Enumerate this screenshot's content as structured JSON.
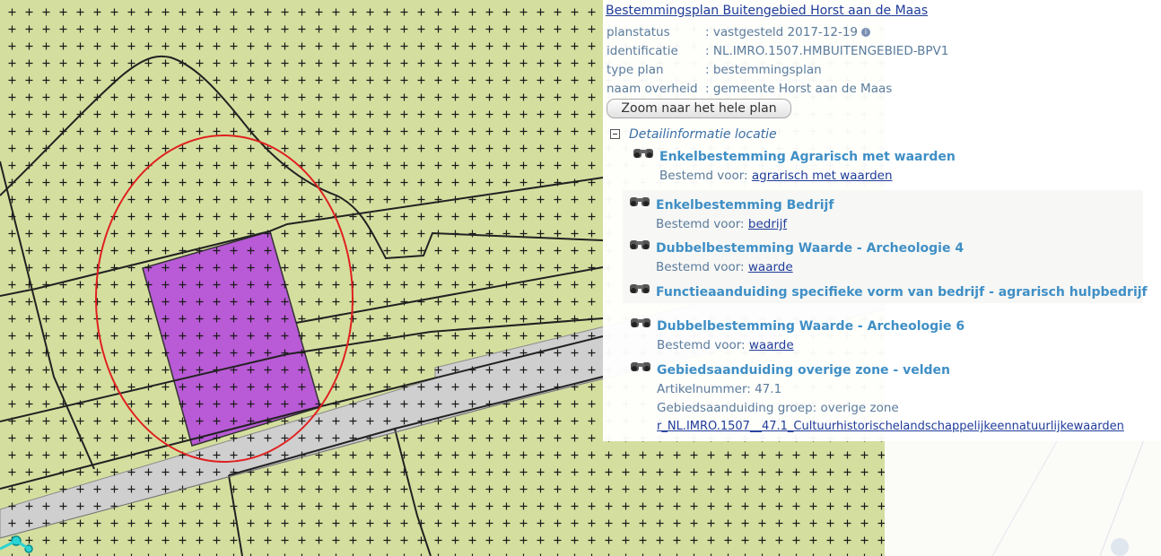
{
  "plan": {
    "title": "Bestemmingsplan Buitengebied Horst aan de Maas",
    "rows": [
      {
        "label": "planstatus",
        "value": ": vastgesteld 2017-12-19"
      },
      {
        "label": "identificatie",
        "value": ": NL.IMRO.1507.HMBUITENGEBIED-BPV1"
      },
      {
        "label": "type plan",
        "value": ": bestemmingsplan"
      },
      {
        "label": "naam overheid",
        "value": ": gemeente Horst aan de Maas"
      }
    ],
    "info_icon": "info-icon",
    "zoom_button": "Zoom naar het hele plan"
  },
  "detail": {
    "heading": "Detailinformatie locatie",
    "items": [
      {
        "title": "Enkelbestemming Agrarisch met waarden",
        "prefix": "Bestemd voor: ",
        "link": "agrarisch met waarden"
      },
      {
        "title": "Enkelbestemming Bedrijf",
        "prefix": "Bestemd voor: ",
        "link": "bedrijf"
      },
      {
        "title": "Dubbelbestemming Waarde - Archeologie 4",
        "prefix": "Bestemd voor: ",
        "link": "waarde"
      },
      {
        "title": "Functieaanduiding specifieke vorm van bedrijf - agrarisch hulpbedrijf"
      },
      {
        "title": "Dubbelbestemming Waarde - Archeologie 6",
        "prefix": "Bestemd voor: ",
        "link": "waarde"
      },
      {
        "title": "Gebiedsaanduiding overige zone - velden",
        "article": "Artikelnummer: 47.1",
        "group": "Gebiedsaanduiding groep: overige zone",
        "link": "r_NL.IMRO.1507__47.1_Cultuurhistorischelandschappelijkeennatuurlijkewaarden"
      }
    ]
  },
  "icons": {
    "binoculars": "binoculars-icon",
    "collapse": "collapse-minus-icon"
  },
  "colors": {
    "map_agri": "#d4df9f",
    "building_plot": "#b95ad6",
    "road": "#cfcfcf",
    "highlight_circle": "#e02020",
    "item_heading": "#3f8fc6"
  }
}
